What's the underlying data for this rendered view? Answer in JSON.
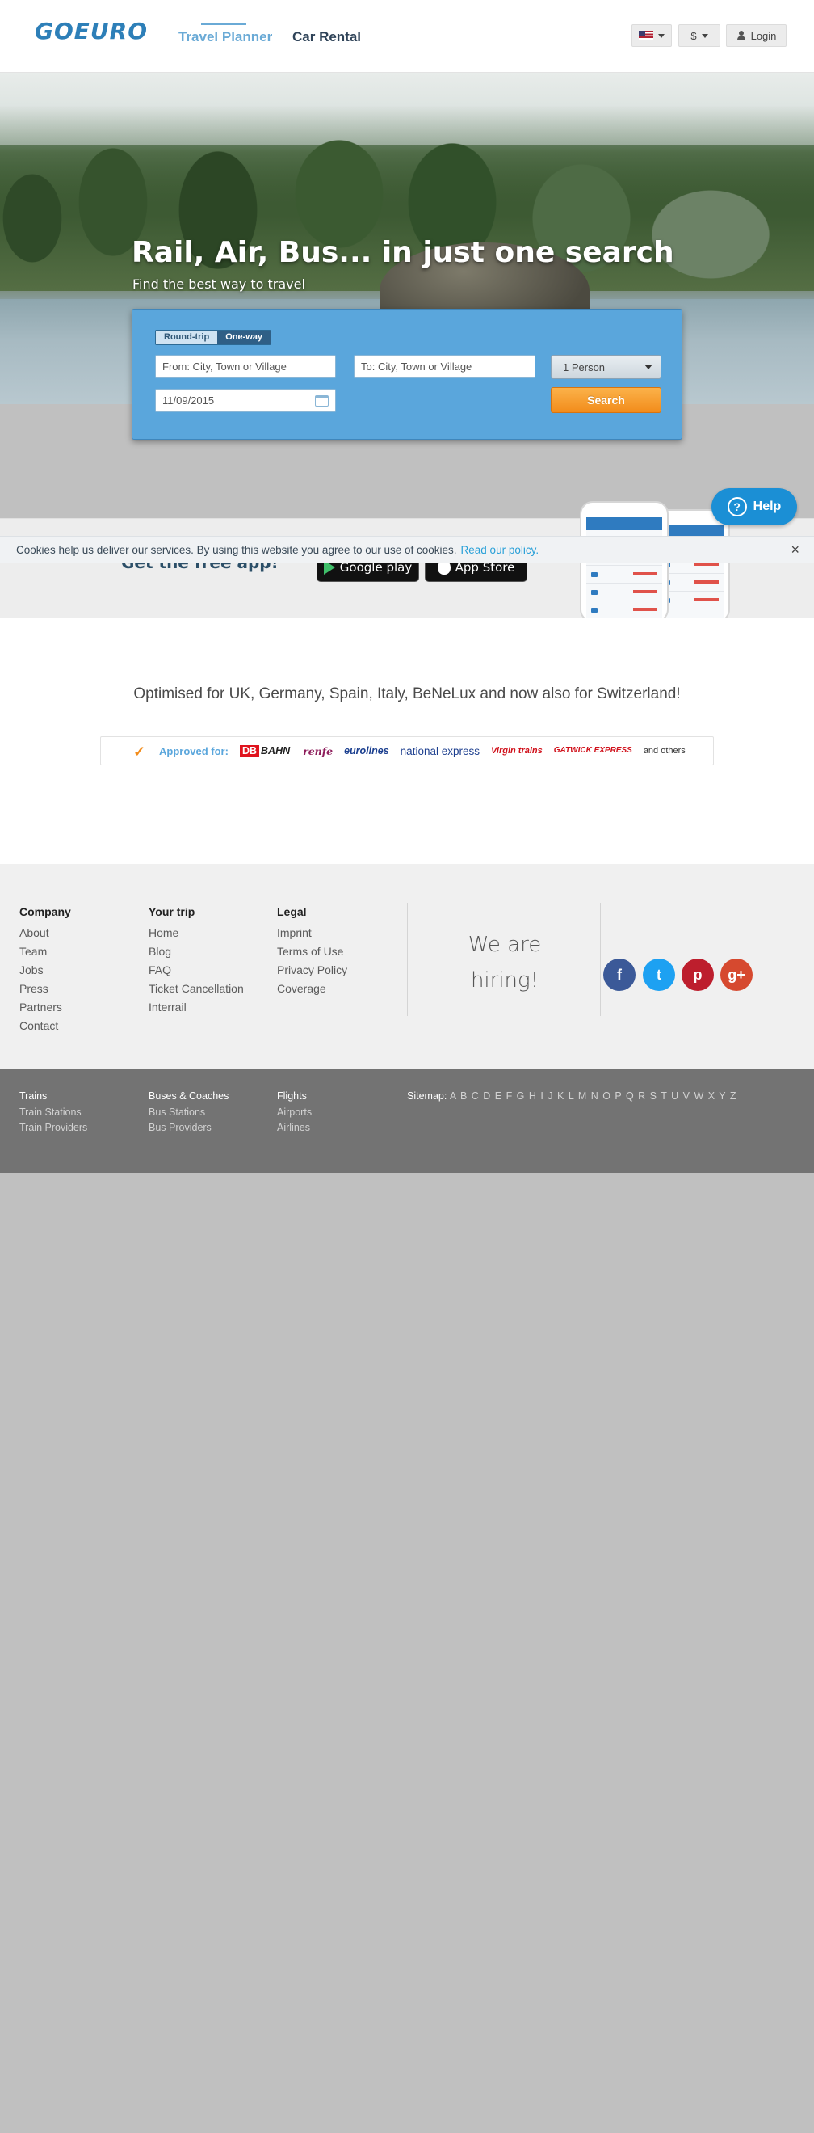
{
  "header": {
    "logo": "GOEURO",
    "nav": [
      {
        "label": "Travel Planner"
      },
      {
        "label": "Car Rental"
      }
    ],
    "currency": "$",
    "login": "Login"
  },
  "hero": {
    "title": "Rail, Air, Bus... in just one search",
    "subtitle": "Find the best way to travel"
  },
  "search": {
    "trip_types": [
      "Round-trip",
      "One-way"
    ],
    "from_placeholder": "From: City, Town or Village",
    "to_placeholder": "To: City, Town or Village",
    "date": "11/09/2015",
    "persons": "1 Person",
    "search_label": "Search"
  },
  "app_banner": {
    "text": "Get the free app!",
    "google_play": "Google play",
    "app_store": "App Store"
  },
  "cookie": {
    "text": "Cookies help us deliver our services. By using this website you agree to our use of cookies.",
    "link": "Read our policy.",
    "close": "×"
  },
  "help": {
    "label": "Help",
    "icon": "?"
  },
  "optimised": "Optimised for UK, Germany, Spain, Italy, BeNeLux and now also for Switzerland!",
  "approved": {
    "label": "Approved for:",
    "partners": {
      "db": "DB",
      "db_name": "BAHN",
      "renfe": "renfe",
      "eurolines": "eurolines",
      "national_express": "national express",
      "virgin": "Virgin trains",
      "gatwick": "GATWICK EXPRESS"
    },
    "others": "and others"
  },
  "footer": {
    "company": {
      "title": "Company",
      "links": [
        "About",
        "Team",
        "Jobs",
        "Press",
        "Partners",
        "Contact"
      ]
    },
    "your_trip": {
      "title": "Your trip",
      "links": [
        "Home",
        "Blog",
        "FAQ",
        "Ticket Cancellation",
        "Interrail"
      ]
    },
    "legal": {
      "title": "Legal",
      "links": [
        "Imprint",
        "Terms of Use",
        "Privacy Policy",
        "Coverage"
      ]
    },
    "hiring": [
      "We are",
      "hiring!"
    ],
    "social": {
      "facebook": "f",
      "twitter": "t",
      "pinterest": "p",
      "googleplus": "g+"
    }
  },
  "footer2": {
    "trains": {
      "title": "Trains",
      "links": [
        "Train Stations",
        "Train Providers"
      ]
    },
    "buses": {
      "title": "Buses & Coaches",
      "links": [
        "Bus Stations",
        "Bus Providers"
      ]
    },
    "flights": {
      "title": "Flights",
      "links": [
        "Airports",
        "Airlines"
      ]
    },
    "sitemap_label": "Sitemap:",
    "sitemap_letters": "A B C D E F G H I J K L M N O P Q R S T U V W X Y Z"
  },
  "colors": {
    "brand": "#2d7fb8",
    "search_panel": "#5aa6dc",
    "search_button": "#f28c1b",
    "help_button": "#1b8fd5",
    "footer_dark": "#737373"
  }
}
